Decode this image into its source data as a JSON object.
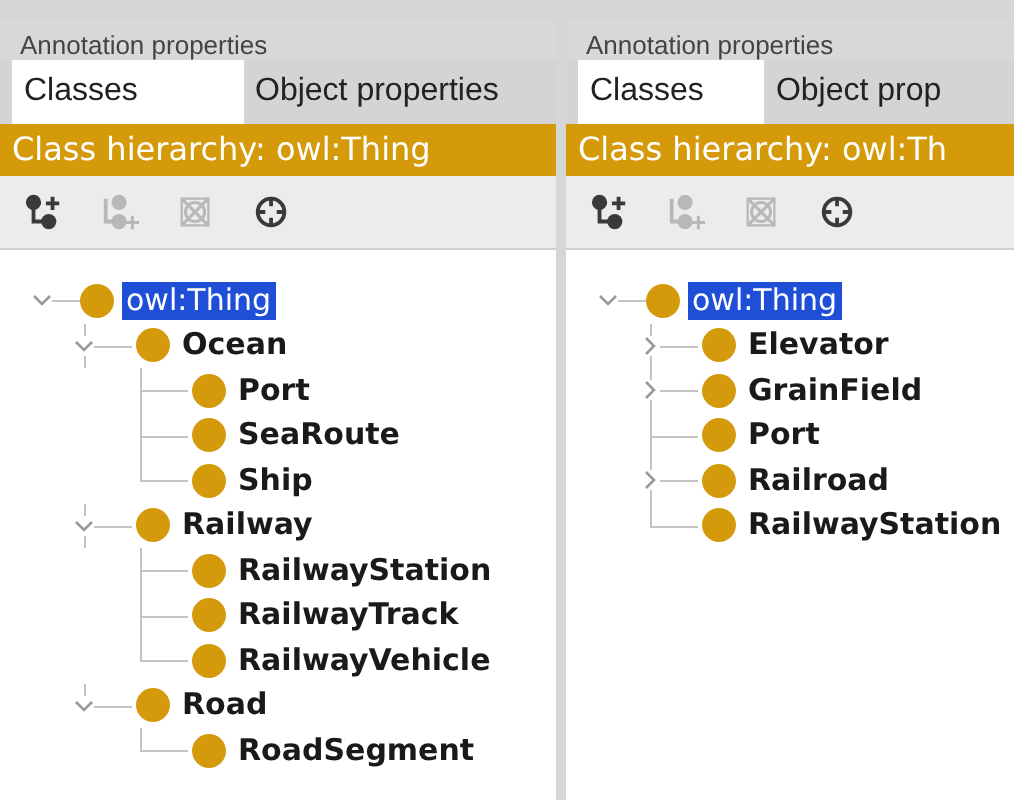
{
  "panels": [
    {
      "annotation_tab": "Annotation properties",
      "tabs": [
        {
          "label": "Classes",
          "selected": true
        },
        {
          "label": "Object properties",
          "selected": false
        }
      ],
      "header": "Class hierarchy: owl:Thing",
      "tools": [
        {
          "kind": "add-subclass",
          "disabled": false
        },
        {
          "kind": "add-sibling",
          "disabled": true
        },
        {
          "kind": "delete",
          "disabled": true
        },
        {
          "kind": "target",
          "disabled": false
        }
      ],
      "tree": {
        "label": "owl:Thing",
        "selected": true,
        "expanded": true,
        "children": [
          {
            "label": "Ocean",
            "selected": false,
            "expanded": true,
            "children": [
              {
                "label": "Port",
                "selected": false
              },
              {
                "label": "SeaRoute",
                "selected": false
              },
              {
                "label": "Ship",
                "selected": false
              }
            ]
          },
          {
            "label": "Railway",
            "selected": false,
            "expanded": true,
            "children": [
              {
                "label": "RailwayStation",
                "selected": false
              },
              {
                "label": "RailwayTrack",
                "selected": false
              },
              {
                "label": "RailwayVehicle",
                "selected": false
              }
            ]
          },
          {
            "label": "Road",
            "selected": false,
            "expanded": true,
            "children": [
              {
                "label": "RoadSegment",
                "selected": false
              }
            ]
          }
        ]
      }
    },
    {
      "annotation_tab": "Annotation properties",
      "tabs": [
        {
          "label": "Classes",
          "selected": true
        },
        {
          "label": "Object prop",
          "selected": false
        }
      ],
      "header": "Class hierarchy: owl:Th",
      "tools": [
        {
          "kind": "add-subclass",
          "disabled": false
        },
        {
          "kind": "add-sibling",
          "disabled": true
        },
        {
          "kind": "delete",
          "disabled": true
        },
        {
          "kind": "target",
          "disabled": false
        }
      ],
      "tree": {
        "label": "owl:Thing",
        "selected": true,
        "expanded": true,
        "children": [
          {
            "label": "Elevator",
            "selected": false,
            "expanded": false
          },
          {
            "label": "GrainField",
            "selected": false,
            "expanded": false
          },
          {
            "label": "Port",
            "selected": false
          },
          {
            "label": "Railroad",
            "selected": false,
            "expanded": false
          },
          {
            "label": "RailwayStation",
            "selected": false
          }
        ]
      }
    }
  ]
}
